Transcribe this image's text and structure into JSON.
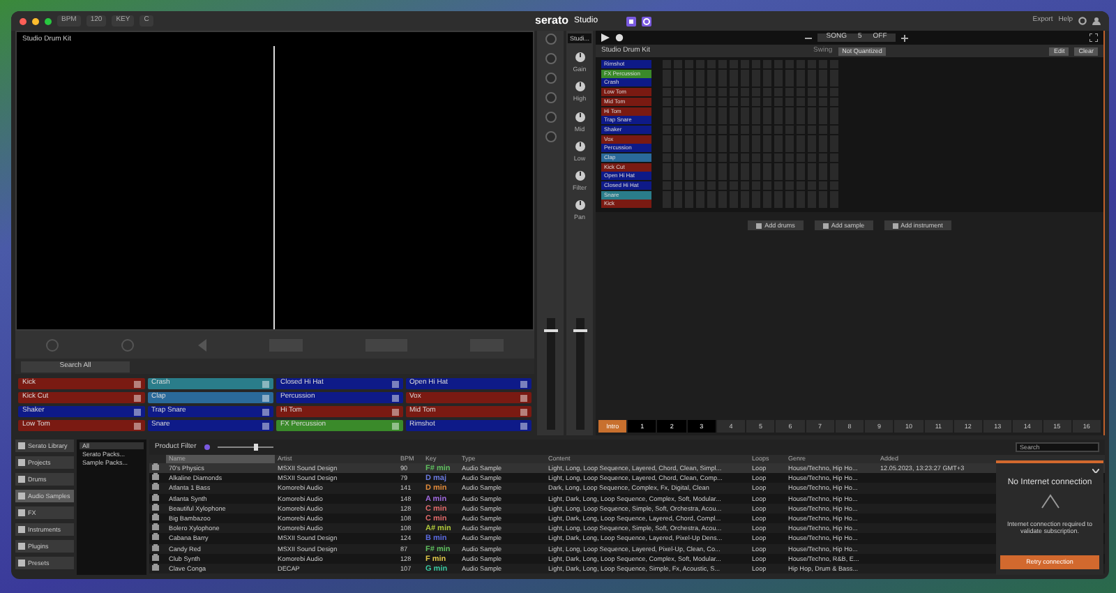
{
  "toolbar": {
    "bpm_label": "BPM",
    "bpm": "120",
    "key_label": "KEY",
    "key": "C",
    "logo": "serato",
    "product": "Studio",
    "export": "Export",
    "help": "Help"
  },
  "display": {
    "title": "Studio Drum Kit"
  },
  "search_all": "Search All",
  "pads": [
    {
      "label": "Kick",
      "color": "#7a1a12"
    },
    {
      "label": "Crash",
      "color": "#2a7d8a"
    },
    {
      "label": "Closed Hi Hat",
      "color": "#0e1a88"
    },
    {
      "label": "Open Hi Hat",
      "color": "#0e1a88"
    },
    {
      "label": "Kick Cut",
      "color": "#7a1a12"
    },
    {
      "label": "Clap",
      "color": "#2a6a9a"
    },
    {
      "label": "Percussion",
      "color": "#0e1a88"
    },
    {
      "label": "Vox",
      "color": "#7a1a12"
    },
    {
      "label": "Shaker",
      "color": "#0e1a88"
    },
    {
      "label": "Trap Snare",
      "color": "#0e1a88"
    },
    {
      "label": "Hi Tom",
      "color": "#7a1a12"
    },
    {
      "label": "Mid Tom",
      "color": "#7a1a12"
    },
    {
      "label": "Low Tom",
      "color": "#7a1a12"
    },
    {
      "label": "Snare",
      "color": "#0e1a88"
    },
    {
      "label": "FX Percussion",
      "color": "#3a8a2a"
    },
    {
      "label": "Rimshot",
      "color": "#0e1a88"
    }
  ],
  "mixer": {
    "channel": "Studi...",
    "knobs": [
      "Gain",
      "High",
      "Mid",
      "Low",
      "Filter",
      "Pan"
    ],
    "faders": [
      {
        "level": 0.9
      },
      {
        "level": 0.9
      }
    ]
  },
  "transport": {
    "mode": "SONG",
    "bars": "5",
    "sync": "OFF"
  },
  "sequencer": {
    "title": "Studio Drum Kit",
    "swing_label": "Swing",
    "swing": "Not Quantized",
    "edit": "Edit",
    "clear": "Clear",
    "tracks": [
      {
        "label": "Rimshot",
        "color": "#0e1a88"
      },
      {
        "label": "FX Percussion",
        "color": "#3a8a2a"
      },
      {
        "label": "Crash",
        "color": "#0e1a88"
      },
      {
        "label": "Low Tom",
        "color": "#7a1a12"
      },
      {
        "label": "Mid Tom",
        "color": "#7a1a12"
      },
      {
        "label": "Hi Tom",
        "color": "#7a1a12"
      },
      {
        "label": "Trap Snare",
        "color": "#0e1a88"
      },
      {
        "label": "Shaker",
        "color": "#0e1a88"
      },
      {
        "label": "Vox",
        "color": "#7a1a12"
      },
      {
        "label": "Percussion",
        "color": "#0e1a88"
      },
      {
        "label": "Clap",
        "color": "#2a6a9a"
      },
      {
        "label": "Kick Cut",
        "color": "#7a1a12"
      },
      {
        "label": "Open Hi Hat",
        "color": "#0e1a88"
      },
      {
        "label": "Closed Hi Hat",
        "color": "#0e1a88"
      },
      {
        "label": "Snare",
        "color": "#2a7d8a"
      },
      {
        "label": "Kick",
        "color": "#7a1a12"
      }
    ]
  },
  "actions": [
    "Add drums",
    "Add sample",
    "Add instrument"
  ],
  "scenes": [
    {
      "label": "Intro",
      "selected": true,
      "filled": true
    },
    {
      "label": "1",
      "selected": false,
      "filled": true
    },
    {
      "label": "2",
      "selected": false,
      "filled": true
    },
    {
      "label": "3",
      "selected": false,
      "filled": true
    },
    {
      "label": "4",
      "selected": false,
      "filled": false
    },
    {
      "label": "5",
      "selected": false,
      "filled": false
    },
    {
      "label": "6",
      "selected": false,
      "filled": false
    },
    {
      "label": "7",
      "selected": false,
      "filled": false
    },
    {
      "label": "8",
      "selected": false,
      "filled": false
    },
    {
      "label": "9",
      "selected": false,
      "filled": false
    },
    {
      "label": "10",
      "selected": false,
      "filled": false
    },
    {
      "label": "11",
      "selected": false,
      "filled": false
    },
    {
      "label": "12",
      "selected": false,
      "filled": false
    },
    {
      "label": "13",
      "selected": false,
      "filled": false
    },
    {
      "label": "14",
      "selected": false,
      "filled": false
    },
    {
      "label": "15",
      "selected": false,
      "filled": false
    },
    {
      "label": "16",
      "selected": false,
      "filled": false
    }
  ],
  "browser": {
    "sidebar": [
      {
        "label": "Serato Library",
        "selected": false
      },
      {
        "label": "Projects",
        "selected": false
      },
      {
        "label": "Drums",
        "selected": false
      },
      {
        "label": "Audio Samples",
        "selected": true
      },
      {
        "label": "FX",
        "selected": false
      },
      {
        "label": "Instruments",
        "selected": false
      },
      {
        "label": "Plugins",
        "selected": false
      },
      {
        "label": "Presets",
        "selected": false
      }
    ],
    "tree": [
      {
        "label": "All",
        "selected": true
      },
      {
        "label": "Serato Packs...",
        "selected": false
      },
      {
        "label": "Sample Packs...",
        "selected": false
      }
    ],
    "filter": "Product Filter",
    "zoom": {
      "level": 0.7
    },
    "search_placeholder": "Search",
    "columns": [
      "Name",
      "Artist",
      "BPM",
      "Key",
      "Type",
      "Content",
      "Loops",
      "Genre",
      "Added"
    ],
    "rows": [
      {
        "selected": true,
        "name": "70's Physics",
        "artist": "MSXII Sound Design",
        "bpm": "90",
        "key": "F# min",
        "color": "#5fbf5f",
        "type": "Audio Sample",
        "content": "Light, Long, Loop Sequence, Layered, Chord, Clean, Simpl...",
        "loop": "Loop",
        "genre": "House/Techno, Hip Ho...",
        "added": "12.05.2023, 13:23:27 GMT+3"
      },
      {
        "selected": false,
        "name": "Alkaline Diamonds",
        "artist": "MSXII Sound Design",
        "bpm": "79",
        "key": "D maj",
        "color": "#6a7ae0",
        "type": "Audio Sample",
        "content": "Light, Long, Loop Sequence, Layered, Chord, Clean, Comp...",
        "loop": "Loop",
        "genre": "House/Techno, Hip Ho..."
      },
      {
        "selected": false,
        "name": "Atlanta 1 Bass",
        "artist": "Komorebi Audio",
        "bpm": "141",
        "key": "D min",
        "color": "#e08a3a",
        "type": "Audio Sample",
        "content": "Dark, Long, Loop Sequence, Complex, Fx, Digital, Clean",
        "loop": "Loop",
        "genre": "House/Techno, Hip Ho..."
      },
      {
        "selected": false,
        "name": "Atlanta Synth",
        "artist": "Komorebi Audio",
        "bpm": "148",
        "key": "A min",
        "color": "#a06ae0",
        "type": "Audio Sample",
        "content": "Light, Dark, Long, Loop Sequence, Complex, Soft, Modular...",
        "loop": "Loop",
        "genre": "House/Techno, Hip Ho..."
      },
      {
        "selected": false,
        "name": "Beautiful Xylophone",
        "artist": "Komorebi Audio",
        "bpm": "128",
        "key": "C min",
        "color": "#e06a6a",
        "type": "Audio Sample",
        "content": "Light, Long, Loop Sequence, Simple, Soft, Orchestra, Acou...",
        "loop": "Loop",
        "genre": "House/Techno, Hip Ho..."
      },
      {
        "selected": false,
        "name": "Big Bambazoo",
        "artist": "Komorebi Audio",
        "bpm": "108",
        "key": "C min",
        "color": "#e06a6a",
        "type": "Audio Sample",
        "content": "Light, Dark, Long, Loop Sequence, Layered, Chord, Compl...",
        "loop": "Loop",
        "genre": "House/Techno, Hip Ho..."
      },
      {
        "selected": false,
        "name": "Bolero Xylophone",
        "artist": "Komorebi Audio",
        "bpm": "108",
        "key": "A# min",
        "color": "#b0c83a",
        "type": "Audio Sample",
        "content": "Light, Long, Loop Sequence, Simple, Soft, Orchestra, Acou...",
        "loop": "Loop",
        "genre": "House/Techno, Hip Ho..."
      },
      {
        "selected": false,
        "name": "Cabana Barry",
        "artist": "MSXII Sound Design",
        "bpm": "124",
        "key": "B min",
        "color": "#5a6ae0",
        "type": "Audio Sample",
        "content": "Light, Dark, Long, Loop Sequence, Layered, Pixel-Up Dens...",
        "loop": "Loop",
        "genre": "House/Techno, Hip Ho..."
      },
      {
        "selected": false,
        "name": "Candy Red",
        "artist": "MSXII Sound Design",
        "bpm": "87",
        "key": "F# min",
        "color": "#5fbf5f",
        "type": "Audio Sample",
        "content": "Light, Long, Loop Sequence, Layered, Pixel-Up, Clean, Co...",
        "loop": "Loop",
        "genre": "House/Techno, Hip Ho..."
      },
      {
        "selected": false,
        "name": "Club Synth",
        "artist": "Komorebi Audio",
        "bpm": "128",
        "key": "F min",
        "color": "#e0c84a",
        "type": "Audio Sample",
        "content": "Light, Dark, Long, Loop Sequence, Complex, Soft, Modular...",
        "loop": "Loop",
        "genre": "House/Techno, R&B, E..."
      },
      {
        "selected": false,
        "name": "Clave Conga",
        "artist": "DECAP",
        "bpm": "107",
        "key": "G min",
        "color": "#3ac8a0",
        "type": "Audio Sample",
        "content": "Light, Dark, Long, Loop Sequence, Simple, Fx, Acoustic, S...",
        "loop": "Loop",
        "genre": "Hip Hop, Drum & Bass..."
      }
    ]
  },
  "popup": {
    "title": "No Internet connection",
    "message": "Internet connection required to validate subscription.",
    "button": "Retry connection"
  }
}
